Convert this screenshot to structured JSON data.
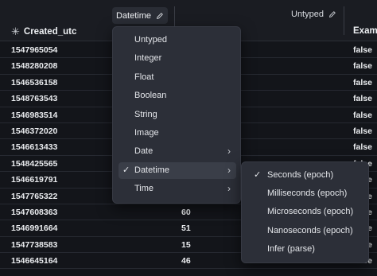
{
  "header": {
    "created_col": "Created_utc",
    "type_chip": "Datetime",
    "untyped_label": "Untyped",
    "example_col": "Examp"
  },
  "rows": [
    {
      "created": "1547965054",
      "value": "",
      "example": "false"
    },
    {
      "created": "1548280208",
      "value": "",
      "example": "false"
    },
    {
      "created": "1546536158",
      "value": "",
      "example": "false"
    },
    {
      "created": "1548763543",
      "value": "",
      "example": "false"
    },
    {
      "created": "1546983514",
      "value": "",
      "example": "false"
    },
    {
      "created": "1546372020",
      "value": "",
      "example": "false"
    },
    {
      "created": "1546613433",
      "value": "",
      "example": "false"
    },
    {
      "created": "1548425565",
      "value": "",
      "example": "false"
    },
    {
      "created": "1546619791",
      "value": "",
      "example": "false"
    },
    {
      "created": "1547765322",
      "value": "",
      "example": "false"
    },
    {
      "created": "1547608363",
      "value": "60",
      "example": "false"
    },
    {
      "created": "1546991664",
      "value": "51",
      "example": "false"
    },
    {
      "created": "1547738583",
      "value": "15",
      "example": "false"
    },
    {
      "created": "1546645164",
      "value": "46",
      "example": "false"
    }
  ],
  "type_menu": {
    "items": [
      {
        "label": "Untyped",
        "has_submenu": false,
        "checked": false
      },
      {
        "label": "Integer",
        "has_submenu": false,
        "checked": false
      },
      {
        "label": "Float",
        "has_submenu": false,
        "checked": false
      },
      {
        "label": "Boolean",
        "has_submenu": false,
        "checked": false
      },
      {
        "label": "String",
        "has_submenu": false,
        "checked": false
      },
      {
        "label": "Image",
        "has_submenu": false,
        "checked": false
      },
      {
        "label": "Date",
        "has_submenu": true,
        "checked": false
      },
      {
        "label": "Datetime",
        "has_submenu": true,
        "checked": true
      },
      {
        "label": "Time",
        "has_submenu": true,
        "checked": false
      }
    ]
  },
  "datetime_submenu": {
    "items": [
      {
        "label": "Seconds (epoch)",
        "checked": true
      },
      {
        "label": "Milliseconds (epoch)",
        "checked": false
      },
      {
        "label": "Microseconds (epoch)",
        "checked": false
      },
      {
        "label": "Nanoseconds (epoch)",
        "checked": false
      },
      {
        "label": "Infer (parse)",
        "checked": false
      }
    ]
  },
  "glyphs": {
    "asterisk": "✳",
    "check": "✓",
    "chevron": "›"
  },
  "colors": {
    "background": "#13151a",
    "menu": "#2c2f38",
    "active_item": "#3a3e48"
  }
}
